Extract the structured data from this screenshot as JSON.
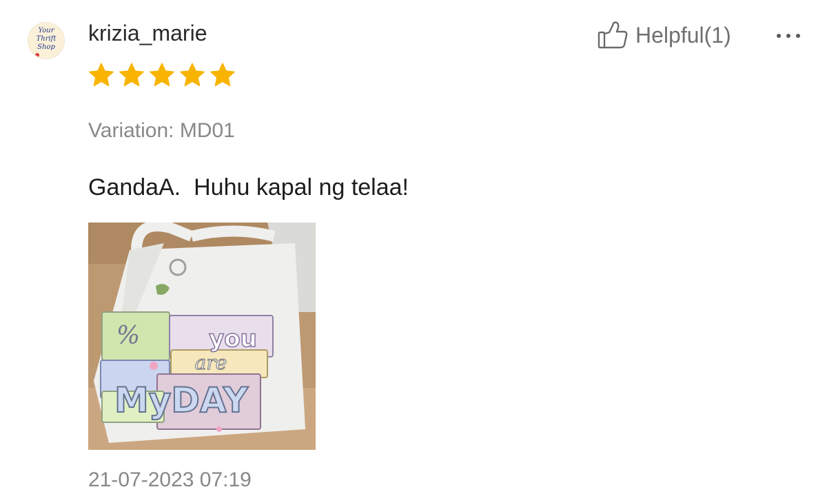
{
  "avatar": {
    "logo_lines": [
      "Your",
      "Thrift",
      "Shop"
    ]
  },
  "review": {
    "username": "krizia_marie",
    "rating": 5,
    "rating_max": 5,
    "star_color": "#f8b400",
    "helpful_label": "Helpful(1)",
    "variation": "Variation: MD01",
    "comment": "GandaA.  Huhu kapal ng telaa!",
    "photo_text": [
      "you",
      "are",
      "MyDAY"
    ],
    "timestamp": "21-07-2023 07:19"
  },
  "icons": {
    "helpful": "thumbs-up-icon",
    "more": "more-options-icon",
    "star": "star-icon"
  }
}
